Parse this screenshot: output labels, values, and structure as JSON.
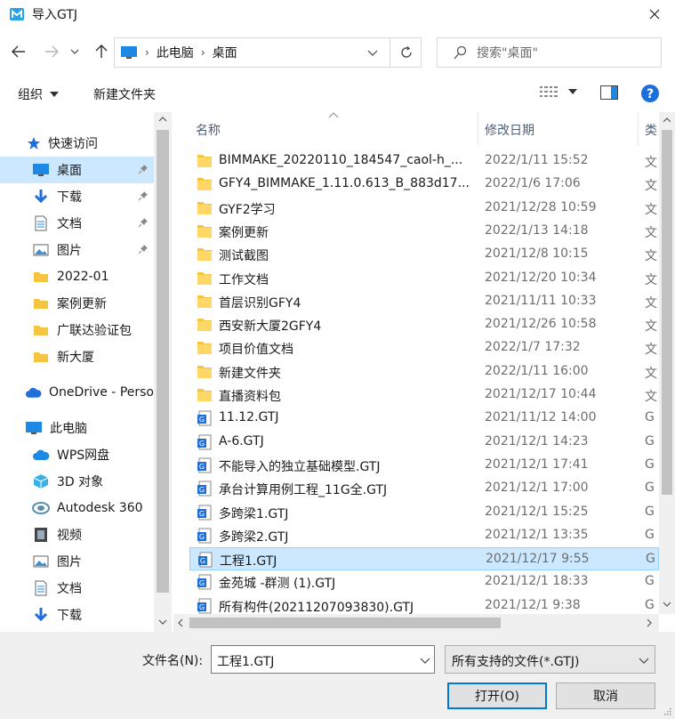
{
  "window": {
    "title": "导入GTJ"
  },
  "nav": {
    "crumbs": [
      "此电脑",
      "桌面"
    ],
    "search_placeholder": "搜索\"桌面\""
  },
  "toolbar": {
    "organize": "组织",
    "new_folder": "新建文件夹"
  },
  "sidebar": {
    "quick_access": "快速访问",
    "items": [
      {
        "label": "桌面",
        "icon": "desktop-icon",
        "pinned": true,
        "selected": true
      },
      {
        "label": "下载",
        "icon": "download-icon",
        "pinned": true
      },
      {
        "label": "文档",
        "icon": "document-icon",
        "pinned": true
      },
      {
        "label": "图片",
        "icon": "picture-icon",
        "pinned": true
      },
      {
        "label": "2022-01",
        "icon": "folder-icon"
      },
      {
        "label": "案例更新",
        "icon": "folder-icon"
      },
      {
        "label": "广联达验证包",
        "icon": "folder-icon"
      },
      {
        "label": "新大厦",
        "icon": "folder-icon"
      }
    ],
    "onedrive": "OneDrive - Perso",
    "this_pc": "此电脑",
    "pc_items": [
      {
        "label": "WPS网盘",
        "icon": "cloud-icon"
      },
      {
        "label": "3D 对象",
        "icon": "cube-icon"
      },
      {
        "label": "Autodesk 360",
        "icon": "autodesk-icon"
      },
      {
        "label": "视频",
        "icon": "video-icon"
      },
      {
        "label": "图片",
        "icon": "picture-icon"
      },
      {
        "label": "文档",
        "icon": "document-icon"
      },
      {
        "label": "下载",
        "icon": "download-icon"
      }
    ]
  },
  "columns": {
    "name": "名称",
    "modified": "修改日期",
    "type": "类"
  },
  "files": [
    {
      "name": "BIMMAKE_20220110_184547_caol-h_...",
      "date": "2022/1/11 15:52",
      "type": "文",
      "kind": "folder"
    },
    {
      "name": "GFY4_BIMMAKE_1.11.0.613_B_883d17...",
      "date": "2022/1/6 17:06",
      "type": "文",
      "kind": "folder"
    },
    {
      "name": "GYF2学习",
      "date": "2021/12/28 10:59",
      "type": "文",
      "kind": "folder"
    },
    {
      "name": "案例更新",
      "date": "2022/1/13 14:18",
      "type": "文",
      "kind": "folder"
    },
    {
      "name": "测试截图",
      "date": "2021/12/8 10:15",
      "type": "文",
      "kind": "folder"
    },
    {
      "name": "工作文档",
      "date": "2021/12/20 10:34",
      "type": "文",
      "kind": "folder"
    },
    {
      "name": "首层识别GFY4",
      "date": "2021/11/11 10:33",
      "type": "文",
      "kind": "folder"
    },
    {
      "name": "西安新大厦2GFY4",
      "date": "2021/12/26 10:58",
      "type": "文",
      "kind": "folder"
    },
    {
      "name": "项目价值文档",
      "date": "2022/1/7 17:32",
      "type": "文",
      "kind": "folder"
    },
    {
      "name": "新建文件夹",
      "date": "2022/1/11 16:00",
      "type": "文",
      "kind": "folder"
    },
    {
      "name": "直播资料包",
      "date": "2021/12/17 10:44",
      "type": "文",
      "kind": "folder"
    },
    {
      "name": "11.12.GTJ",
      "date": "2021/11/12 14:00",
      "type": "G",
      "kind": "gtj"
    },
    {
      "name": "A-6.GTJ",
      "date": "2021/12/1 14:23",
      "type": "G",
      "kind": "gtj"
    },
    {
      "name": "不能导入的独立基础模型.GTJ",
      "date": "2021/12/1 17:41",
      "type": "G",
      "kind": "gtj"
    },
    {
      "name": "承台计算用例工程_11G全.GTJ",
      "date": "2021/12/1 17:00",
      "type": "G",
      "kind": "gtj"
    },
    {
      "name": "多跨梁1.GTJ",
      "date": "2021/12/1 15:25",
      "type": "G",
      "kind": "gtj"
    },
    {
      "name": "多跨梁2.GTJ",
      "date": "2021/12/1 13:35",
      "type": "G",
      "kind": "gtj"
    },
    {
      "name": "工程1.GTJ",
      "date": "2021/12/17 9:55",
      "type": "G",
      "kind": "gtj",
      "selected": true
    },
    {
      "name": "金苑城 -群测 (1).GTJ",
      "date": "2021/12/1 18:33",
      "type": "G",
      "kind": "gtj"
    },
    {
      "name": "所有构件(20211207093830).GTJ",
      "date": "2021/12/1 9:38",
      "type": "G",
      "kind": "gtj"
    }
  ],
  "footer": {
    "filename_label": "文件名(N):",
    "filename_value": "工程1.GTJ",
    "filetype": "所有支持的文件(*.GTJ)",
    "open": "打开(O)",
    "cancel": "取消"
  },
  "colors": {
    "selection": "#cce8ff",
    "folder": "#f5c542",
    "accent": "#0078d7"
  }
}
